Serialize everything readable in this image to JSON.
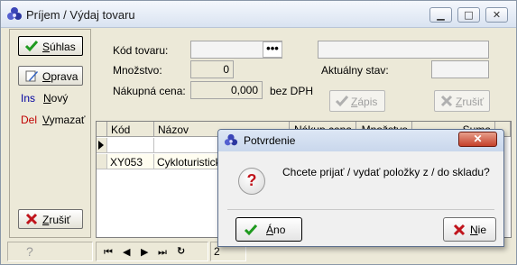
{
  "window": {
    "title": "Príjem / Výdaj tovaru",
    "controls": {
      "minimize": "▁",
      "maximize": "□",
      "close": "✕"
    }
  },
  "left_panel": {
    "suhlas": {
      "prefix": "S",
      "rest": "úhlas"
    },
    "oprava": {
      "prefix": "O",
      "rest": "prava"
    },
    "novy": {
      "key": "Ins",
      "prefix": "N",
      "rest": "ový"
    },
    "vymazat": {
      "key": "Del",
      "prefix": "V",
      "rest": "ymazať"
    },
    "zrusit": {
      "prefix": "Z",
      "rest": "rušiť"
    }
  },
  "form": {
    "kod_label": "Kód tovaru:",
    "kod_value": "",
    "lookup_label": "•••",
    "mnozstvo_label": "Množstvo:",
    "mnozstvo_value": "0",
    "cena_label": "Nákupná cena:",
    "cena_value": "0,000",
    "cena_suffix": "bez DPH",
    "nazov_value": "",
    "stav_label": "Aktuálny stav:",
    "stav_value": "",
    "zapis": {
      "prefix": "Z",
      "rest": "ápis"
    },
    "zrusit": {
      "prefix": "Z",
      "rest": "rušiť"
    }
  },
  "grid": {
    "columns": [
      "Kód",
      "Názov",
      "Nákup.cena",
      "Množstvo",
      "Suma"
    ],
    "rows": [
      {
        "kod": "",
        "nazov": ""
      },
      {
        "kod": "XY053",
        "nazov": "Cykloturistická"
      }
    ]
  },
  "statusbar": {
    "help": "?",
    "nav": [
      "⏮",
      "◀",
      "▶",
      "⏭",
      "↻"
    ],
    "page": "2"
  },
  "dialog": {
    "title": "Potvrdenie",
    "close": "✕",
    "icon": "?",
    "message": "Chcete prijať / vydať položky z / do skladu?",
    "yes": {
      "prefix": "Á",
      "rest": "no"
    },
    "no": {
      "prefix": "N",
      "rest": "ie"
    }
  },
  "colors": {
    "accent_green": "#1f9a1f",
    "danger_red": "#c0141c",
    "del_red": "#c00000",
    "ins_blue": "#0000a0"
  }
}
